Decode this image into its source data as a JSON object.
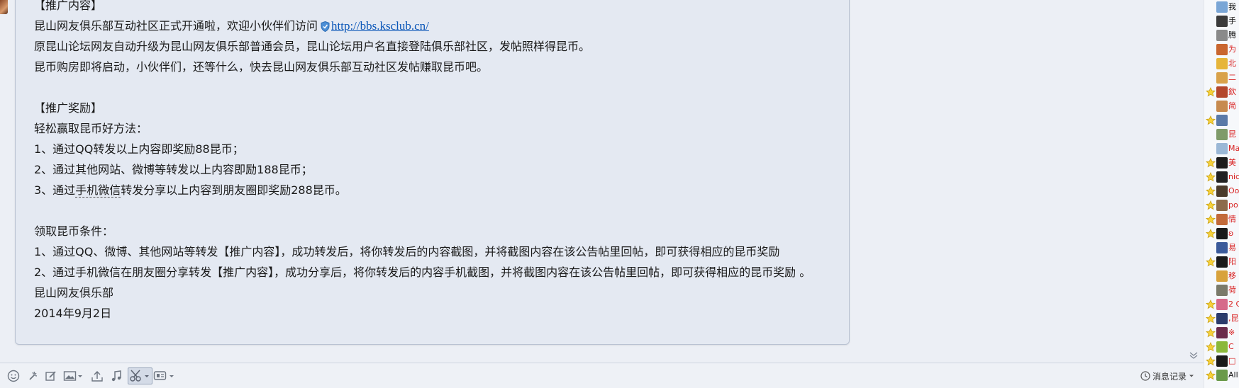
{
  "message": {
    "lines": [
      "【推广内容】",
      "昆山网友俱乐部互动社区正式开通啦，欢迎小伙伴们访问",
      "原昆山论坛网友自动升级为昆山网友俱乐部普通会员，昆山论坛用户名直接登陆俱乐部社区，发帖照样得昆币。",
      "昆币购房即将启动，小伙伴们，还等什么，快去昆山网友俱乐部互动社区发帖赚取昆币吧。",
      "",
      "【推广奖励】",
      "轻松赢取昆币好方法：",
      "1、通过QQ转发以上内容即奖励88昆币；",
      "2、通过其他网站、微博等转发以上内容即励188昆币；",
      "3、通过",
      "",
      "领取昆币条件：",
      "1、通过QQ、微博、其他网站等转发【推广内容】，成功转发后，将你转发后的内容截图，并将截图内容在该公告帖里回帖，即可获得相应的昆币奖励",
      "2、通过手机微信在朋友圈分享转发【推广内容】，成功分享后，将你转发后的内容手机截图，并将截图内容在该公告帖里回帖，即可获得相应的昆币奖励 。",
      "昆山网友俱乐部",
      "2014年9月2日"
    ],
    "link_url": "http://bbs.ksclub.cn/",
    "wechat_keyword": "手机微信",
    "line10_suffix": "转发分享以上内容到朋友圈即奖励288昆币。"
  },
  "toolbar": {
    "icons": [
      "emoji-icon",
      "shake-icon",
      "edit-icon",
      "image-icon",
      "upload-icon",
      "music-icon",
      "screenshot-icon",
      "more-icon"
    ],
    "history_label": "消息记录"
  },
  "members": [
    {
      "name": "我",
      "starred": false,
      "red": false,
      "avatar": "#7aa6d6"
    },
    {
      "name": "手",
      "starred": false,
      "red": false,
      "avatar": "#3b3b3b"
    },
    {
      "name": "腾",
      "starred": false,
      "red": false,
      "avatar": "#8a8a8a"
    },
    {
      "name": "为",
      "starred": false,
      "red": true,
      "avatar": "#c9662f"
    },
    {
      "name": "北",
      "starred": false,
      "red": true,
      "avatar": "#e6b53a"
    },
    {
      "name": "二",
      "starred": false,
      "red": true,
      "avatar": "#d9a24a"
    },
    {
      "name": "欽",
      "starred": true,
      "red": true,
      "avatar": "#b4472c"
    },
    {
      "name": "简",
      "starred": false,
      "red": true,
      "avatar": "#c78a4f"
    },
    {
      "name": "",
      "starred": true,
      "red": false,
      "avatar": "#5a7aa8"
    },
    {
      "name": "昆",
      "starred": false,
      "red": true,
      "avatar": "#7f9b6a"
    },
    {
      "name": "Ma",
      "starred": false,
      "red": true,
      "avatar": "#9bb8d6"
    },
    {
      "name": "美",
      "starred": true,
      "red": true,
      "avatar": "#1c1c1c"
    },
    {
      "name": "nic",
      "starred": true,
      "red": true,
      "avatar": "#222222"
    },
    {
      "name": "Oo",
      "starred": true,
      "red": true,
      "avatar": "#4b3b2b"
    },
    {
      "name": "po:",
      "starred": true,
      "red": true,
      "avatar": "#8c6b4a"
    },
    {
      "name": "情",
      "starred": true,
      "red": true,
      "avatar": "#c26a3a"
    },
    {
      "name": "ʚ",
      "starred": true,
      "red": true,
      "avatar": "#1a1a1a"
    },
    {
      "name": "易",
      "starred": false,
      "red": true,
      "avatar": "#3a5a9a"
    },
    {
      "name": "阳",
      "starred": true,
      "red": true,
      "avatar": "#1a1a1a"
    },
    {
      "name": "移",
      "starred": false,
      "red": true,
      "avatar": "#d8a23c"
    },
    {
      "name": "荷",
      "starred": false,
      "red": true,
      "avatar": "#7a7a6a"
    },
    {
      "name": "2 C",
      "starred": true,
      "red": true,
      "avatar": "#d66a8a"
    },
    {
      "name": ",昆",
      "starred": true,
      "red": true,
      "avatar": "#2b3b6b"
    },
    {
      "name": "※",
      "starred": true,
      "red": true,
      "avatar": "#6b2b4b"
    },
    {
      "name": "C",
      "starred": true,
      "red": true,
      "avatar": "#8bb83a"
    },
    {
      "name": "□",
      "starred": true,
      "red": true,
      "avatar": "#1a1a1a"
    },
    {
      "name": "All",
      "starred": true,
      "red": false,
      "avatar": "#6a9a4a"
    }
  ]
}
